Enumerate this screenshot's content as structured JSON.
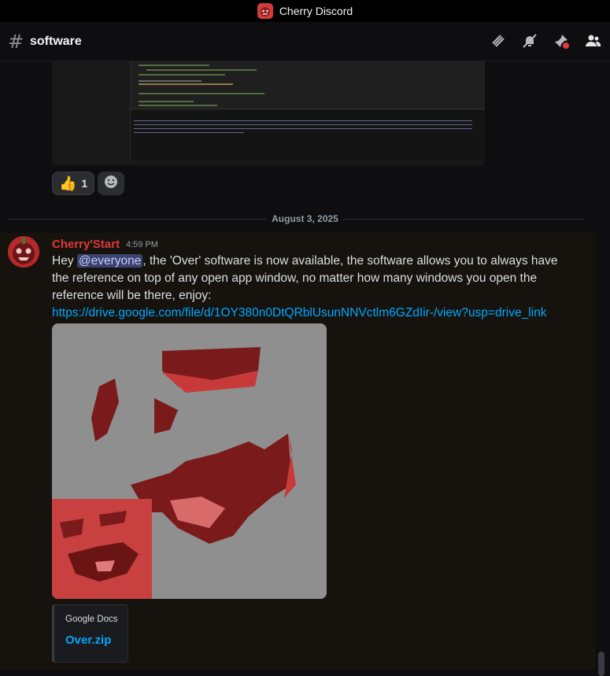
{
  "window": {
    "title": "Cherry Discord"
  },
  "channel": {
    "name": "software"
  },
  "header_icons": [
    "threads-icon",
    "mute-bell-icon",
    "pin-icon",
    "members-icon"
  ],
  "reactions": [
    {
      "emoji": "👍",
      "count": "1"
    },
    {
      "emoji": "add-reaction-icon",
      "count": ""
    }
  ],
  "date_divider": "August 3, 2025",
  "message": {
    "author": "Cherry'Start",
    "timestamp": "4:59 PM",
    "text_before_mention": "Hey ",
    "mention": "@everyone",
    "text_after_mention": ", the 'Over' software is now available, the software allows you to always have the reference on top of any open app window, no matter how many windows you open the reference will be there, enjoy:",
    "link": "https://drive.google.com/file/d/1OY380n0DtQRblUsunNNVctlm6GZdIir-/view?usp=drive_link",
    "embed": {
      "provider": "Google Docs",
      "title": "Over.zip"
    }
  },
  "colors": {
    "author": "#e03838",
    "link": "#00a8fc",
    "mention_bg": "#3c4270",
    "accent": "#c84040"
  }
}
